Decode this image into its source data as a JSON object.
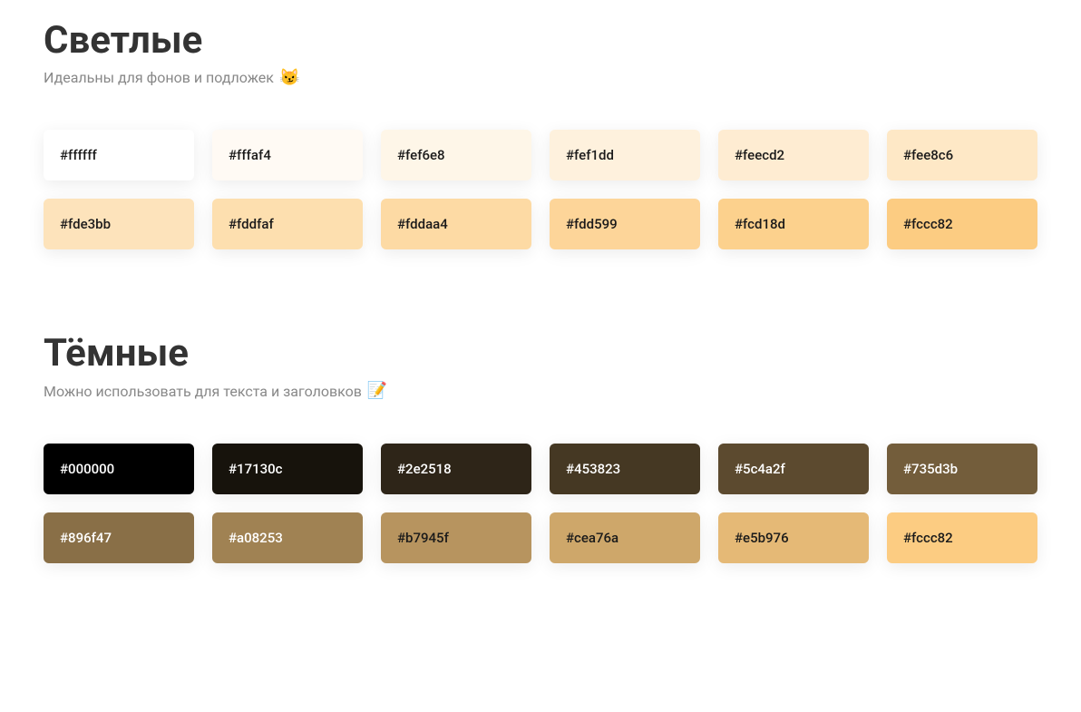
{
  "sections": [
    {
      "title": "Светлые",
      "subtitle": "Идеальны для фонов и подложек",
      "emoji": "😼",
      "swatches": [
        {
          "hex": "#ffffff",
          "textClass": "text-dark"
        },
        {
          "hex": "#fffaf4",
          "textClass": "text-dark"
        },
        {
          "hex": "#fef6e8",
          "textClass": "text-dark"
        },
        {
          "hex": "#fef1dd",
          "textClass": "text-dark"
        },
        {
          "hex": "#feecd2",
          "textClass": "text-dark"
        },
        {
          "hex": "#fee8c6",
          "textClass": "text-dark"
        },
        {
          "hex": "#fde3bb",
          "textClass": "text-dark"
        },
        {
          "hex": "#fddfaf",
          "textClass": "text-dark"
        },
        {
          "hex": "#fddaa4",
          "textClass": "text-dark"
        },
        {
          "hex": "#fdd599",
          "textClass": "text-dark"
        },
        {
          "hex": "#fcd18d",
          "textClass": "text-dark"
        },
        {
          "hex": "#fccc82",
          "textClass": "text-dark"
        }
      ]
    },
    {
      "title": "Тёмные",
      "subtitle": "Можно использовать для текста и заголовков",
      "emoji": "📝",
      "swatches": [
        {
          "hex": "#000000",
          "textClass": "text-light"
        },
        {
          "hex": "#17130c",
          "textClass": "text-light"
        },
        {
          "hex": "#2e2518",
          "textClass": "text-light"
        },
        {
          "hex": "#453823",
          "textClass": "text-light"
        },
        {
          "hex": "#5c4a2f",
          "textClass": "text-light"
        },
        {
          "hex": "#735d3b",
          "textClass": "text-light"
        },
        {
          "hex": "#896f47",
          "textClass": "text-light"
        },
        {
          "hex": "#a08253",
          "textClass": "text-light"
        },
        {
          "hex": "#b7945f",
          "textClass": "text-dark"
        },
        {
          "hex": "#cea76a",
          "textClass": "text-dark"
        },
        {
          "hex": "#e5b976",
          "textClass": "text-dark"
        },
        {
          "hex": "#fccc82",
          "textClass": "text-dark"
        }
      ]
    }
  ]
}
